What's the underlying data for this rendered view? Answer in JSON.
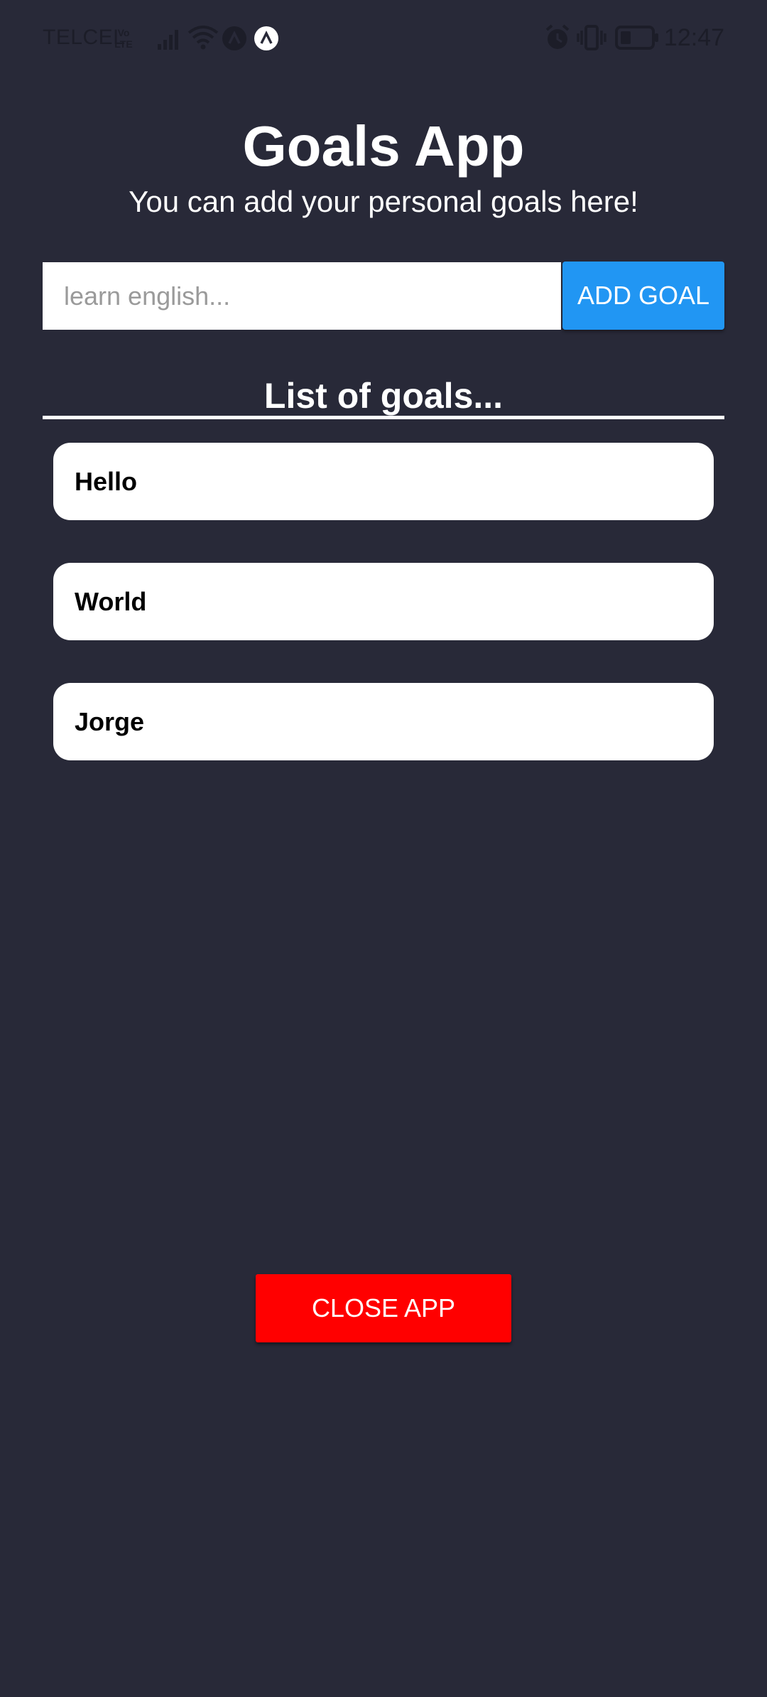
{
  "status_bar": {
    "carrier": "TELCEL",
    "network_badge": "Vo LTE",
    "time": "12:47",
    "icons": [
      "signal-icon",
      "wifi-icon",
      "app-notification-icon",
      "expo-icon",
      "alarm-icon",
      "vibrate-icon",
      "battery-icon"
    ]
  },
  "header": {
    "title": "Goals App",
    "subtitle": "You can add your personal goals here!"
  },
  "goal_input": {
    "value": "",
    "placeholder": "learn english..."
  },
  "add_button": {
    "label": "ADD GOAL"
  },
  "list": {
    "heading": "List of goals...",
    "items": [
      {
        "label": "Hello"
      },
      {
        "label": "World"
      },
      {
        "label": "Jorge"
      }
    ]
  },
  "close_button": {
    "label": "CLOSE APP"
  },
  "colors": {
    "background": "#282938",
    "accent_blue": "#2196f3",
    "close_red": "#ff0000",
    "item_background": "#ffffff"
  }
}
